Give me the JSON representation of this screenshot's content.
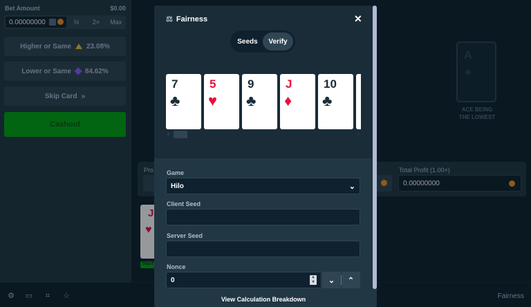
{
  "sidebar": {
    "bet_amount_label": "Bet Amount",
    "bet_amount_usd": "$0.00",
    "bet_value": "0.00000000",
    "half_label": "½",
    "double_label": "2×",
    "max_label": "Max",
    "higher_label": "Higher or Same",
    "higher_pct": "23.08%",
    "lower_label": "Lower or Same",
    "lower_pct": "84.62%",
    "skip_label": "Skip Card",
    "skip_icon": "»",
    "cashout_label": "Cashout"
  },
  "game": {
    "deck_rank": "A",
    "deck_caption_1": "ACE BEING",
    "deck_caption_2": "THE LOWEST",
    "profit_left_label": "Pro",
    "total_profit_label": "Total Profit (1.00×)",
    "total_profit_value": "0.00000000",
    "history_rank": "J",
    "history_suit": "♥",
    "start_label": "Start"
  },
  "footer": {
    "fairness_label": "Fairness"
  },
  "modal": {
    "title": "Fairness",
    "tabs": [
      {
        "label": "Seeds",
        "active": false
      },
      {
        "label": "Verify",
        "active": true
      }
    ],
    "cards": [
      {
        "rank": "7",
        "suit": "♣",
        "color": "black"
      },
      {
        "rank": "5",
        "suit": "♥",
        "color": "red"
      },
      {
        "rank": "9",
        "suit": "♣",
        "color": "black"
      },
      {
        "rank": "J",
        "suit": "♦",
        "color": "red"
      },
      {
        "rank": "10",
        "suit": "♣",
        "color": "black"
      },
      {
        "rank": "",
        "suit": "",
        "color": "black"
      }
    ],
    "game_label": "Game",
    "game_value": "Hilo",
    "client_seed_label": "Client Seed",
    "client_seed_value": "",
    "server_seed_label": "Server Seed",
    "server_seed_value": "",
    "nonce_label": "Nonce",
    "nonce_value": "0",
    "calc_link": "View Calculation Breakdown"
  },
  "colors": {
    "background": "#0f212e",
    "panel": "#213743",
    "modal": "#1a2c38",
    "accent_green": "#00a611",
    "red_suit": "#e9113c"
  }
}
